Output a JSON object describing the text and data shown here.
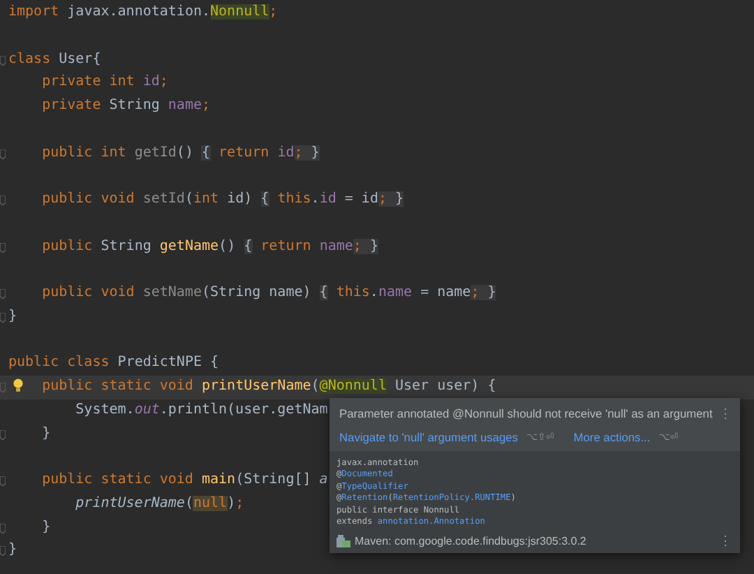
{
  "editor": {
    "lines": [
      {
        "kind": "code",
        "fold_marker": false,
        "intention_bulb": false,
        "current": false,
        "tokens": [
          {
            "kind": "keyword",
            "text": "import "
          },
          {
            "kind": "plain",
            "text": "javax.annotation."
          },
          {
            "kind": "annotation",
            "text": "Nonnull"
          },
          {
            "kind": "keyword",
            "text": ";"
          }
        ]
      },
      {
        "kind": "blank"
      },
      {
        "kind": "code",
        "fold_marker": true,
        "intention_bulb": false,
        "current": false,
        "tokens": [
          {
            "kind": "keyword",
            "text": "class "
          },
          {
            "kind": "plain",
            "text": "User{"
          }
        ]
      },
      {
        "kind": "code",
        "fold_marker": false,
        "intention_bulb": false,
        "current": false,
        "tokens": [
          {
            "kind": "keyword",
            "text": "    private int "
          },
          {
            "kind": "field",
            "text": "id"
          },
          {
            "kind": "keyword",
            "text": ";"
          }
        ]
      },
      {
        "kind": "code",
        "fold_marker": false,
        "intention_bulb": false,
        "current": false,
        "tokens": [
          {
            "kind": "keyword",
            "text": "    private "
          },
          {
            "kind": "plain",
            "text": "String "
          },
          {
            "kind": "field",
            "text": "name"
          },
          {
            "kind": "keyword",
            "text": ";"
          }
        ]
      },
      {
        "kind": "blank"
      },
      {
        "kind": "code",
        "fold_marker": true,
        "intention_bulb": false,
        "current": false,
        "tokens": [
          {
            "kind": "keyword",
            "text": "    public int "
          },
          {
            "kind": "unused",
            "text": "getId"
          },
          {
            "kind": "plain",
            "text": "() "
          },
          {
            "kind": "fold",
            "text": "{"
          },
          {
            "kind": "keyword",
            "text": " return "
          },
          {
            "kind": "field",
            "text": "id"
          },
          {
            "kind": "fold-keyword",
            "text": ";"
          },
          {
            "kind": "fold",
            "text": " }"
          }
        ]
      },
      {
        "kind": "blank"
      },
      {
        "kind": "code",
        "fold_marker": true,
        "intention_bulb": false,
        "current": false,
        "tokens": [
          {
            "kind": "keyword",
            "text": "    public void "
          },
          {
            "kind": "unused",
            "text": "setId"
          },
          {
            "kind": "plain",
            "text": "("
          },
          {
            "kind": "keyword",
            "text": "int "
          },
          {
            "kind": "plain",
            "text": "id) "
          },
          {
            "kind": "fold",
            "text": "{"
          },
          {
            "kind": "keyword",
            "text": " this"
          },
          {
            "kind": "plain",
            "text": "."
          },
          {
            "kind": "field",
            "text": "id"
          },
          {
            "kind": "plain",
            "text": " = id"
          },
          {
            "kind": "fold-keyword",
            "text": ";"
          },
          {
            "kind": "fold",
            "text": " }"
          }
        ]
      },
      {
        "kind": "blank"
      },
      {
        "kind": "code",
        "fold_marker": true,
        "intention_bulb": false,
        "current": false,
        "tokens": [
          {
            "kind": "keyword",
            "text": "    public "
          },
          {
            "kind": "plain",
            "text": "String "
          },
          {
            "kind": "declaration",
            "text": "getName"
          },
          {
            "kind": "plain",
            "text": "() "
          },
          {
            "kind": "fold",
            "text": "{"
          },
          {
            "kind": "keyword",
            "text": " return "
          },
          {
            "kind": "field",
            "text": "name"
          },
          {
            "kind": "fold-keyword",
            "text": ";"
          },
          {
            "kind": "fold",
            "text": " }"
          }
        ]
      },
      {
        "kind": "blank"
      },
      {
        "kind": "code",
        "fold_marker": true,
        "intention_bulb": false,
        "current": false,
        "tokens": [
          {
            "kind": "keyword",
            "text": "    public void "
          },
          {
            "kind": "unused",
            "text": "setName"
          },
          {
            "kind": "plain",
            "text": "(String name) "
          },
          {
            "kind": "fold",
            "text": "{"
          },
          {
            "kind": "keyword",
            "text": " this"
          },
          {
            "kind": "plain",
            "text": "."
          },
          {
            "kind": "field",
            "text": "name"
          },
          {
            "kind": "plain",
            "text": " = name"
          },
          {
            "kind": "fold-keyword",
            "text": ";"
          },
          {
            "kind": "fold",
            "text": " }"
          }
        ]
      },
      {
        "kind": "code",
        "fold_marker": true,
        "intention_bulb": false,
        "current": false,
        "tokens": [
          {
            "kind": "plain",
            "text": "}"
          }
        ]
      },
      {
        "kind": "blank"
      },
      {
        "kind": "code",
        "fold_marker": false,
        "intention_bulb": false,
        "current": false,
        "tokens": [
          {
            "kind": "keyword",
            "text": "public class "
          },
          {
            "kind": "plain",
            "text": "PredictNPE {"
          }
        ]
      },
      {
        "kind": "code",
        "fold_marker": true,
        "intention_bulb": true,
        "current": true,
        "tokens": [
          {
            "kind": "keyword",
            "text": "    public static void "
          },
          {
            "kind": "declaration",
            "text": "printUserName"
          },
          {
            "kind": "plain",
            "text": "("
          },
          {
            "kind": "annotation",
            "text": "@Nonnull"
          },
          {
            "kind": "plain",
            "text": " User user) {"
          }
        ]
      },
      {
        "kind": "code",
        "fold_marker": false,
        "intention_bulb": false,
        "current": false,
        "tokens": [
          {
            "kind": "plain",
            "text": "        System."
          },
          {
            "kind": "static",
            "text": "out"
          },
          {
            "kind": "plain",
            "text": ".println(user.getNam"
          }
        ]
      },
      {
        "kind": "code",
        "fold_marker": true,
        "intention_bulb": false,
        "current": false,
        "tokens": [
          {
            "kind": "plain",
            "text": "    }"
          }
        ]
      },
      {
        "kind": "blank"
      },
      {
        "kind": "code",
        "fold_marker": true,
        "intention_bulb": false,
        "current": false,
        "tokens": [
          {
            "kind": "keyword",
            "text": "    public static void "
          },
          {
            "kind": "declaration",
            "text": "main"
          },
          {
            "kind": "plain",
            "text": "(String[] "
          },
          {
            "kind": "italic",
            "text": "a"
          }
        ]
      },
      {
        "kind": "code",
        "fold_marker": false,
        "intention_bulb": false,
        "current": false,
        "tokens": [
          {
            "kind": "italic",
            "text": "        printUserName"
          },
          {
            "kind": "plain",
            "text": "("
          },
          {
            "kind": "null",
            "text": "null"
          },
          {
            "kind": "plain",
            "text": ")"
          },
          {
            "kind": "keyword",
            "text": ";"
          }
        ]
      },
      {
        "kind": "code",
        "fold_marker": true,
        "intention_bulb": false,
        "current": false,
        "tokens": [
          {
            "kind": "plain",
            "text": "    }"
          }
        ]
      },
      {
        "kind": "code",
        "fold_marker": true,
        "intention_bulb": false,
        "current": false,
        "tokens": [
          {
            "kind": "plain",
            "text": "}"
          }
        ]
      }
    ]
  },
  "popup": {
    "message": "Parameter annotated @Nonnull should not receive 'null' as an argument",
    "menu": "⋮",
    "actions": [
      {
        "label": "Navigate to 'null' argument usages",
        "shortcut": "⌥⇧⏎"
      },
      {
        "label": "More actions...",
        "shortcut": "⌥⏎"
      }
    ],
    "doc": [
      [
        {
          "kind": "plain",
          "text": "javax.annotation"
        }
      ],
      [
        {
          "kind": "plain",
          "text": "@"
        },
        {
          "kind": "link",
          "text": "Documented"
        }
      ],
      [
        {
          "kind": "plain",
          "text": "@"
        },
        {
          "kind": "link",
          "text": "TypeQualifier"
        }
      ],
      [
        {
          "kind": "plain",
          "text": "@"
        },
        {
          "kind": "link",
          "text": "Retention"
        },
        {
          "kind": "plain",
          "text": "("
        },
        {
          "kind": "link",
          "text": "RetentionPolicy.RUNTIME"
        },
        {
          "kind": "plain",
          "text": ")"
        }
      ],
      [
        {
          "kind": "plain",
          "text": "public interface Nonnull"
        }
      ],
      [
        {
          "kind": "plain",
          "text": "extends "
        },
        {
          "kind": "link",
          "text": "annotation.Annotation"
        }
      ]
    ],
    "source": "Maven: com.google.code.findbugs:jsr305:3.0.2",
    "source_menu": "⋮"
  }
}
